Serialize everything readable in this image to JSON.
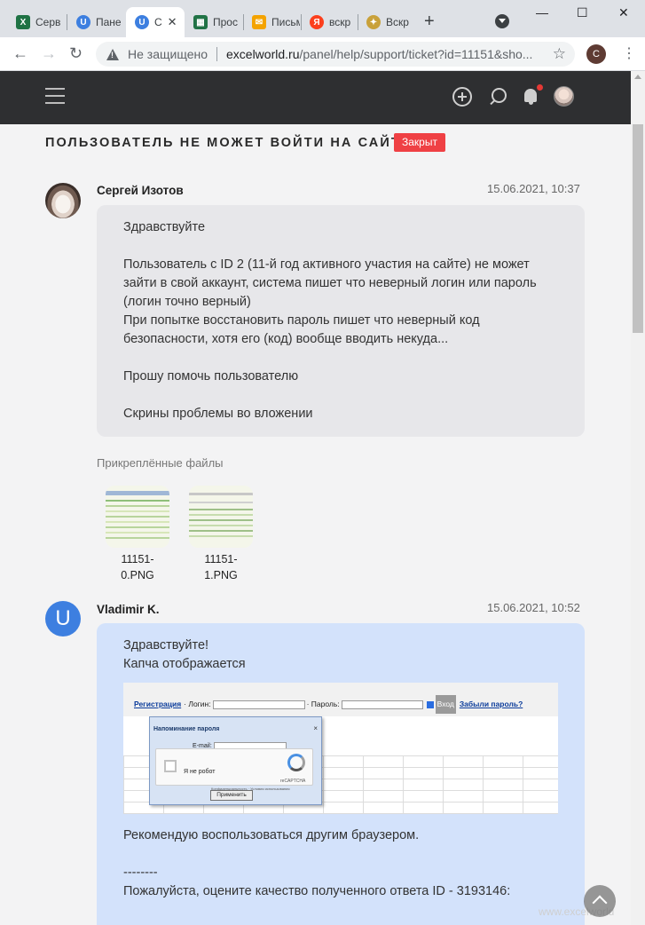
{
  "browser": {
    "tabs": [
      {
        "label": "Серв",
        "icon": "excel-icon",
        "color": "#1f7244"
      },
      {
        "label": "Пане",
        "icon": "u-logo-icon",
        "color": "#3d7fe0"
      },
      {
        "label": "С",
        "icon": "u-logo-icon",
        "color": "#3d7fe0",
        "active": true
      },
      {
        "label": "Прос",
        "icon": "chart-icon",
        "color": "#217346"
      },
      {
        "label": "Письм",
        "icon": "mail-icon",
        "color": "#f4a300"
      },
      {
        "label": "вскр",
        "icon": "yandex-icon",
        "color": "#fc3f1d"
      },
      {
        "label": "Вскр",
        "icon": "emblem-icon",
        "color": "#c9a13a"
      }
    ],
    "new_tab": "+",
    "window_controls": {
      "minimize": "—",
      "maximize": "☐",
      "close": "✕"
    },
    "nav": {
      "back": "←",
      "forward": "→",
      "reload": "↻"
    },
    "security_text": "Не защищено",
    "url_host": "excelworld.ru",
    "url_path": "/panel/help/support/ticket?id=11151&sho...",
    "star": "☆",
    "profile_initial": "С",
    "menu": "⋮"
  },
  "ticket": {
    "title": "ПОЛЬЗОВАТЕЛЬ НЕ МОЖЕТ ВОЙТИ НА САЙТ",
    "status": "Закрыт",
    "status_color": "#ef4044"
  },
  "messages": [
    {
      "author": "Сергей Изотов",
      "datetime": "15.06.2021, 10:37",
      "avatar": "photo",
      "lines": [
        "Здравствуйте",
        "",
        "Пользователь с ID 2 (11-й год активного участия на сайте) не может зайти в свой аккаунт, система пишет что неверный логин или пароль (логин точно верный)",
        "При попытке восстановить пароль пишет что неверный код безопасности, хотя его (код) вообще вводить некуда...",
        "",
        "Прошу помочь пользователю",
        "",
        "Скрины проблемы во вложении"
      ],
      "attachments_label": "Прикреплённые файлы",
      "attachments": [
        {
          "name_line1": "11151-",
          "name_line2": "0.PNG"
        },
        {
          "name_line1": "11151-",
          "name_line2": "1.PNG"
        }
      ]
    },
    {
      "author": "Vladimir K.",
      "datetime": "15.06.2021, 10:52",
      "avatar_letter": "U",
      "avatar_color": "#3d7fe0",
      "lines_before": [
        "Здравствуйте!",
        "Капча отображается"
      ],
      "screenshot": {
        "register": "Регистрация",
        "login_label": "· Логин:",
        "password_label": "· Пароль:",
        "login_button": "Вход",
        "forgot": "Забыли пароль?",
        "dialog_title": "Напоминание пароля",
        "dialog_close": "×",
        "email_label": "E-mail:",
        "not_robot": "Я не робот",
        "recaptcha": "reCAPTCHA",
        "terms": "Конфиденциальность · Условия использования",
        "apply": "Применить"
      },
      "lines_after": [
        "Рекомендую воспользоваться другим браузером.",
        "",
        "--------",
        "Пожалуйста, оцените качество полученного ответа ID - 3193146:"
      ]
    }
  ],
  "watermark": "www.excelworld"
}
